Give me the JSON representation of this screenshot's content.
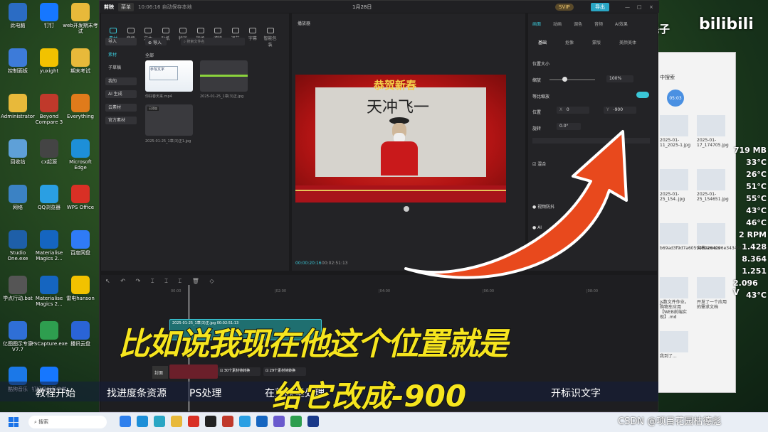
{
  "desktop": {
    "icons": [
      {
        "label": "此电脑",
        "color": "#2b6cc4"
      },
      {
        "label": "钉钉",
        "color": "#1677ff"
      },
      {
        "label": "web开发期末考试",
        "color": "#e8b93a"
      },
      {
        "label": "控制面板",
        "color": "#3d7bd9"
      },
      {
        "label": "yuxight",
        "color": "#f2c200"
      },
      {
        "label": "期末考试",
        "color": "#e8b93a"
      },
      {
        "label": "Administrator",
        "color": "#e8b93a"
      },
      {
        "label": "Beyond Compare 3",
        "color": "#c0392b"
      },
      {
        "label": "Everything",
        "color": "#e07b1b"
      },
      {
        "label": "回收站",
        "color": "#5ea0d8"
      },
      {
        "label": "cx起源",
        "color": "#444"
      },
      {
        "label": "Microsoft Edge",
        "color": "#1d8fd8"
      },
      {
        "label": "网络",
        "color": "#3b82c4"
      },
      {
        "label": "QQ浏览器",
        "color": "#2a9fe3"
      },
      {
        "label": "WPS Office",
        "color": "#d93025"
      },
      {
        "label": "Studio One.exe",
        "color": "#1e5fa8"
      },
      {
        "label": "Materialise Magics 2...",
        "color": "#1565c0"
      },
      {
        "label": "百度网盘",
        "color": "#2f7bf6"
      },
      {
        "label": "学点行动.bat",
        "color": "#555"
      },
      {
        "label": "Materialise Magics 2...",
        "color": "#1565c0"
      },
      {
        "label": "雷电hanson",
        "color": "#f2c200"
      },
      {
        "label": "亿图图示专家V7.7",
        "color": "#2f6fd6"
      },
      {
        "label": "FSCapture.exe",
        "color": "#2e9e4f"
      },
      {
        "label": "播讯云盘",
        "color": "#2a64d6"
      },
      {
        "label": "酷狗音乐",
        "color": "#1b78e8"
      },
      {
        "label": "钉钉视频客户端",
        "color": "#1677ff"
      }
    ]
  },
  "editor": {
    "app_name": "剪映",
    "menu_label": "菜单",
    "status": "10:06:16 自动保存本地",
    "date_title": "1月28日",
    "svip": "SVIP",
    "export": "导出",
    "media_tabs": [
      "素材",
      "音频",
      "文本",
      "贴纸",
      "特效",
      "转场",
      "滤镜",
      "调节",
      "字幕",
      "智能包装"
    ],
    "sidebar": [
      "导入",
      "素材",
      "子草稿",
      "我的",
      "AI 生成",
      "云素材",
      "官方素材"
    ],
    "import_btn": "导入",
    "search_placeholder": "搜索文件名",
    "all_label": "全部",
    "thumbs": [
      {
        "label": "你好春天来.mp4"
      },
      {
        "label": "2025-01-25_1章(3)正.jpg"
      },
      {
        "label": "2025-01-25_1章(3)正1.jpg"
      }
    ],
    "player_title": "播放器",
    "banner_text": "恭贺新春",
    "calligraphy": "天冲飞一",
    "time_current": "00:00:20:16",
    "time_total": "00:02:51:13",
    "right_tabs": [
      "画面",
      "动画",
      "调色",
      "音频",
      "AI效果"
    ],
    "sub_tabs": [
      "基础",
      "抠像",
      "蒙版",
      "美颜美体"
    ],
    "props": {
      "position_size": "位置大小",
      "scale_label": "缩放",
      "scale_value": "100%",
      "uniform_scale": "等比缩放",
      "position_label": "位置",
      "pos_x_label": "X",
      "pos_x": "0",
      "pos_y_label": "Y",
      "pos_y": "-900",
      "rotate_label": "旋转",
      "rotate_value": "0.0°",
      "blend_label": "混合",
      "stabilize_label": "视频防抖",
      "ai_label": "AI"
    },
    "timeline": {
      "ticks": [
        "00:00",
        "|02:00",
        "|04:00",
        "|06:00",
        "|08:00"
      ],
      "clip_label": "2025-01-25_1章(3)正.jpg  00:02:51:13",
      "cover_label": "封面",
      "strip1": "30个素材待转换",
      "strip2": "29个素材待转换"
    }
  },
  "subtitles": {
    "line1": "比如说我现在他这个位置就是",
    "line2": "给它改成-900"
  },
  "bottom_bar": [
    "教程开始",
    "找进度条资源",
    "PS处理",
    "在剪映里处理",
    "开标识文字"
  ],
  "watermark_top": "伴鱼的耗子",
  "watermark_bili": "bilibili",
  "csdn_watermark": "CSDN @项目花园枯德彪",
  "right_window": {
    "title": "中搜索",
    "clock": "05:03",
    "files": [
      "2025-01-11_2025-1.jpg",
      "2025-01-17_174705.jpg",
      "2025-01-25_154..jpg",
      "2025-01-25_154651.jpg",
      "b69ad3f9d7a6059489264296e34349b023bba9d.jpg",
      "文档.ammx",
      "js数文件作业。购物车应用【WEB前端实现】.md",
      "开发了一个应用的需求文档",
      "我到了..."
    ],
    "hw_stats": [
      "719 MB",
      "33°C",
      "26°C",
      "51°C",
      "55°C",
      "43°C",
      "46°C",
      "2 RPM",
      "1.428",
      "8.364",
      "1.251",
      "2.096 V",
      "43°C"
    ],
    "ai_badge": "AI"
  },
  "taskbar": {
    "search_placeholder": "搜索"
  },
  "colors": {
    "accent": "#3ac6d6",
    "subtitle": "#f6e51e",
    "arrow": "#e8491d"
  }
}
